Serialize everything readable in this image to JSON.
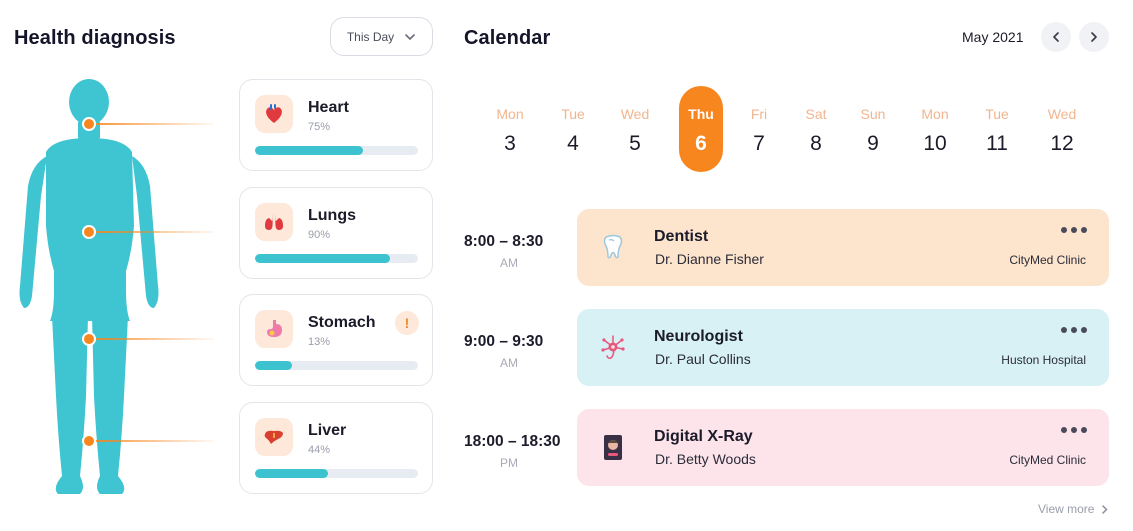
{
  "health": {
    "title": "Health diagnosis",
    "period": "This Day",
    "organs": [
      {
        "name": "Heart",
        "percent_label": "75%",
        "level": 0.66,
        "icon": "heart-organ-icon",
        "alert": false
      },
      {
        "name": "Lungs",
        "percent_label": "90%",
        "level": 0.83,
        "icon": "lungs-icon",
        "alert": false
      },
      {
        "name": "Stomach",
        "percent_label": "13%",
        "level": 0.23,
        "icon": "stomach-icon",
        "alert": true,
        "alert_mark": "!"
      },
      {
        "name": "Liver",
        "percent_label": "44%",
        "level": 0.45,
        "icon": "liver-icon",
        "alert": false
      }
    ]
  },
  "calendar": {
    "title": "Calendar",
    "month": "May 2021",
    "days": [
      {
        "name": "Mon",
        "date": "3"
      },
      {
        "name": "Tue",
        "date": "4"
      },
      {
        "name": "Wed",
        "date": "5"
      },
      {
        "name": "Thu",
        "date": "6",
        "active": true
      },
      {
        "name": "Fri",
        "date": "7"
      },
      {
        "name": "Sat",
        "date": "8"
      },
      {
        "name": "Sun",
        "date": "9"
      },
      {
        "name": "Mon",
        "date": "10"
      },
      {
        "name": "Tue",
        "date": "11"
      },
      {
        "name": "Wed",
        "date": "12"
      }
    ],
    "appointments": [
      {
        "time": "8:00 – 8:30",
        "ampm": "AM",
        "type": "Dentist",
        "doctor": "Dr. Dianne Fisher",
        "clinic": "CityMed Clinic",
        "color": "#fde4cd",
        "icon": "tooth-icon"
      },
      {
        "time": "9:00 – 9:30",
        "ampm": "AM",
        "type": "Neurologist",
        "doctor": "Dr. Paul Collins",
        "clinic": "Huston Hospital",
        "color": "#d8f1f4",
        "icon": "neuron-icon"
      },
      {
        "time": "18:00 – 18:30",
        "ampm": "PM",
        "type": "Digital X-Ray",
        "doctor": "Dr. Betty Woods",
        "clinic": "CityMed Clinic",
        "color": "#fce4ea",
        "icon": "xray-icon"
      }
    ],
    "view_more": "View more"
  },
  "colors": {
    "accent": "#f7861e",
    "teal": "#3cc3cf"
  }
}
